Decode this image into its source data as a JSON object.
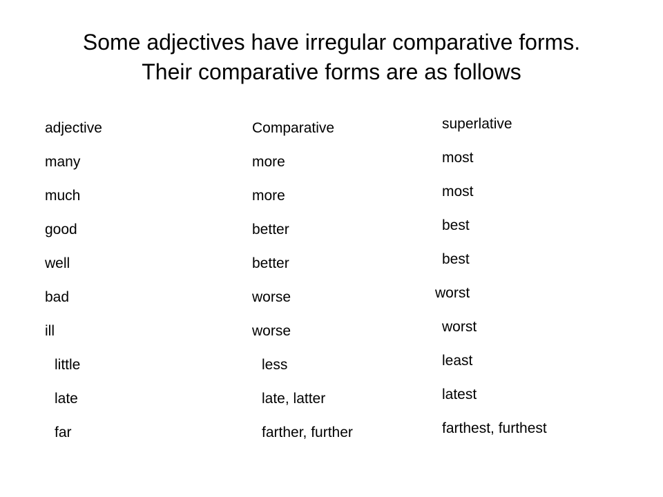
{
  "title_line1": "Some adjectives have irregular comparative forms.",
  "title_line2": "Their comparative forms are as follows",
  "headers": {
    "adjective": "adjective",
    "comparative": "Comparative",
    "superlative": "superlative"
  },
  "rows": [
    {
      "adj": "many",
      "comp": "more",
      "sup": "most"
    },
    {
      "adj": "much",
      "comp": "more",
      "sup": "most"
    },
    {
      "adj": "good",
      "comp": "better",
      "sup": "best"
    },
    {
      "adj": "well",
      "comp": "better",
      "sup": "best"
    },
    {
      "adj": "bad",
      "comp": "worse",
      "sup": "worst"
    },
    {
      "adj": "ill",
      "comp": "worse",
      "sup": "worst"
    },
    {
      "adj": "little",
      "comp": "less",
      "sup": "least"
    },
    {
      "adj": "late",
      "comp": "late, latter",
      "sup": "latest"
    },
    {
      "adj": "far",
      "comp": "farther, further",
      "sup": "farthest, furthest"
    }
  ]
}
